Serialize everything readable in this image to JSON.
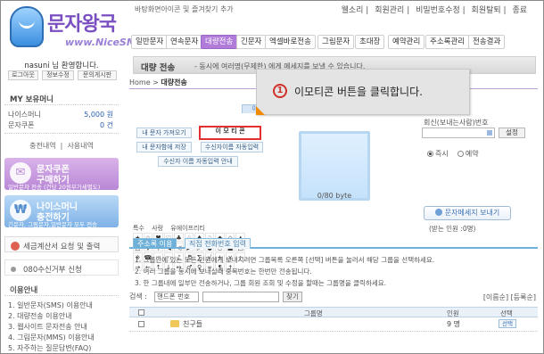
{
  "header": {
    "logo_title": "문자왕국",
    "logo_url": "www.NiceSMS.co.kr",
    "tagline": "바탕화면아이콘 및 즐겨찾기 추가",
    "top_links": [
      "웰소리",
      "회원관리",
      "비밀번호수정",
      "회원탈퇴",
      "종료"
    ],
    "nav": [
      "일반문자",
      "연속문자",
      "대량전송",
      "긴문자",
      "엑셀바로전송",
      "그림문자",
      "초대장",
      "예약관리",
      "주소록관리",
      "전송결과"
    ],
    "active_nav": "대량전송"
  },
  "sidebar": {
    "welcome": "nasuni 님 환영합니다.",
    "mini_buttons": [
      "로그아웃",
      "정보수정",
      "문의게시판"
    ],
    "my_title": "MY 보유머니",
    "nice_money_label": "나이스머니",
    "nice_money_value": "5,000 원",
    "coupon_label": "문자쿠폰",
    "coupon_value": "0 건",
    "links": [
      "충전내역",
      "사용내역"
    ],
    "banner1": {
      "t1": "문자쿠폰",
      "t2": "구매하기",
      "t3": "일반문자 전송 (건당 20원부가세별도)"
    },
    "banner2": {
      "t1": "나이스머니",
      "t2": "충전하기",
      "t3": "긴문자, 그림문자,일반문자 모두 전송"
    },
    "tax_box": "세금계산서 요청 및 출력",
    "receiver_box": "080수신거부 신청",
    "info_title": "이용안내",
    "info_items": [
      "1. 일반문자(SMS) 이용안내",
      "2. 대량전송 이용안내",
      "3. 웹사이트 문자전송 안내",
      "4. 그림문자(MMS) 이용안내",
      "5. 자주하는 질문답변(FAQ)"
    ]
  },
  "main": {
    "title": "대량 전송",
    "subtitle": "- 동시에 여러명(무제한) 에게 메세지를 보낼 수 있습니다.",
    "breadcrumb": [
      "Home",
      "대량전송"
    ],
    "emo_tab": "이미",
    "emo_buttons": [
      "내 문자 가져오기",
      "이 모 티 콘",
      "내 문자함에 저장",
      "수신자이름 자동입력",
      "수신자 이름 자동입력 안내"
    ],
    "emo_categories": [
      "특수",
      "사랑",
      "유에이프리티"
    ],
    "symbols": [
      "★",
      "☆",
      "♥",
      "♡",
      "♣",
      "♧",
      "♠",
      "♤",
      "◆",
      "◇",
      "▲",
      "△",
      "▼",
      "▽",
      "◀",
      "◁",
      "▶",
      "▷",
      "●",
      "○",
      "■",
      "□",
      "※",
      "☎",
      "☞",
      "☜",
      "♪",
      "♬",
      "∑",
      "√",
      "±",
      "×",
      "÷",
      "→",
      "←",
      "↑",
      "↓",
      "↔",
      "♂",
      "♀",
      "∞",
      "¶",
      "†"
    ],
    "byte_count": "0/80 byte",
    "sender_label": "회신(보내는사람)번호",
    "setup_button": "설정",
    "radio_now": "즉시",
    "radio_reserve": "예약",
    "send_button": "문자메세지 보내기",
    "recipients": "(받는 인원 :0명)"
  },
  "address_book": {
    "tabs": [
      "주소록 이용",
      "직접 전화번호 입력"
    ],
    "notes": [
      "1. 그룹안에 있는 모든 인원에게 보내시려면 그룹목록 오른쪽 [선택] 버튼을 눌러서 해당 그룹을 선택하세요.",
      "2. 여러 그룹을 동시에 보내실때 중복번호는 한번만 전송됩니다.",
      "3. 한 그룹내에 일부만 전송하거나, 그룹 회원 조회 및 수정을 할때는 그룹명을 클릭하세요."
    ],
    "search_label": "검색 :",
    "search_option": "핸드폰 번호",
    "search_button": "찾기",
    "sort_links": "[이름순] [등록순]",
    "columns": [
      "그룹명",
      "인원",
      "선택"
    ],
    "rows": [
      {
        "group": "친구들",
        "count": "9 명",
        "select": "선택"
      }
    ]
  },
  "callout": {
    "number": "1",
    "text": "이모티콘 버튼을 클릭합니다."
  }
}
